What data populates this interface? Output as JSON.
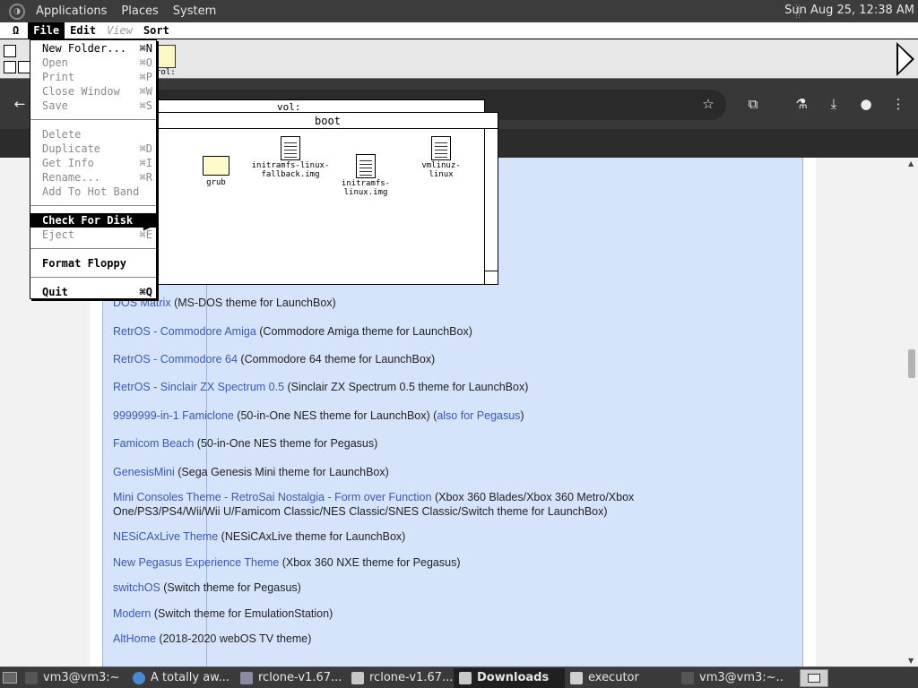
{
  "gnome": {
    "menus": [
      "Applications",
      "Places",
      "System"
    ],
    "clock": "Sun Aug 25, 12:38 AM"
  },
  "mac_menubar": {
    "apple": "Ω",
    "items": [
      {
        "label": "File",
        "state": "selected"
      },
      {
        "label": "Edit",
        "state": "normal"
      },
      {
        "label": "View",
        "state": "disabled"
      },
      {
        "label": "Sort",
        "state": "normal"
      }
    ]
  },
  "mac_desktop": {
    "disk_label": "rol:"
  },
  "file_menu": {
    "items": [
      {
        "label": "New Folder...",
        "key": "⌘N",
        "state": "enabled"
      },
      {
        "label": "Open",
        "key": "⌘O",
        "state": "disabled"
      },
      {
        "label": "Print",
        "key": "⌘P",
        "state": "disabled"
      },
      {
        "label": "Close Window",
        "key": "⌘W",
        "state": "disabled"
      },
      {
        "label": "Save",
        "key": "⌘S",
        "state": "disabled"
      },
      {
        "label": "Delete",
        "key": "",
        "state": "disabled"
      },
      {
        "label": "Duplicate",
        "key": "⌘D",
        "state": "disabled"
      },
      {
        "label": "Get Info",
        "key": "⌘I",
        "state": "disabled"
      },
      {
        "label": "Rename...",
        "key": "⌘R",
        "state": "disabled"
      },
      {
        "label": "Add To Hot Band",
        "key": "",
        "state": "disabled"
      },
      {
        "label": "Check For Disk",
        "key": "",
        "state": "highlighted"
      },
      {
        "label": "Eject",
        "key": "⌘E",
        "state": "disabled"
      },
      {
        "label": "Format Floppy",
        "key": "",
        "state": "bold"
      },
      {
        "label": "Quit",
        "key": "⌘Q",
        "state": "bold"
      }
    ]
  },
  "vol_window": {
    "title": "vol:"
  },
  "boot_window": {
    "title": "boot",
    "files": [
      {
        "name": "grub",
        "type": "folder"
      },
      {
        "name": "initramfs-linux-fallback.img",
        "type": "document"
      },
      {
        "name": "initramfs-linux.img",
        "type": "document"
      },
      {
        "name": "vmlinuz-linux",
        "type": "document"
      }
    ]
  },
  "page_list": [
    {
      "link": "DOS Matrix",
      "text": " (MS-DOS theme for LaunchBox)"
    },
    {
      "link": "RetrOS - Commodore Amiga",
      "text": " (Commodore Amiga theme for LaunchBox)"
    },
    {
      "link": "RetrOS - Commodore 64",
      "text": " (Commodore 64 theme for LaunchBox)"
    },
    {
      "link": "RetrOS - Sinclair ZX Spectrum 0.5",
      "text": " (Sinclair ZX Spectrum 0.5 theme for LaunchBox)"
    },
    {
      "link": "9999999-in-1 Famiclone",
      "text": " (50-in-One NES theme for LaunchBox) (",
      "link2": "also for Pegasus",
      "text2": ")"
    },
    {
      "link": "Famicom Beach",
      "text": " (50-in-One NES theme for Pegasus)"
    },
    {
      "link": "GenesisMini",
      "text": " (Sega Genesis Mini theme for LaunchBox)"
    },
    {
      "link": "Mini Consoles Theme - RetroSai Nostalgia - Form over Function",
      "text": " (Xbox 360 Blades/Xbox 360 Metro/Xbox One/PS3/PS4/Wii/Wii U/Famicom Classic/NES Classic/SNES Classic/Switch theme for LaunchBox)"
    },
    {
      "link": "NESiCAxLive Theme",
      "text": " (NESiCAxLive theme for LaunchBox)"
    },
    {
      "link": "New Pegasus Experience Theme",
      "text": " (Xbox 360 NXE theme for Pegasus)"
    },
    {
      "link": "switchOS",
      "text": " (Switch theme for Pegasus)"
    },
    {
      "link": "Modern",
      "text": " (Switch theme for EmulationStation)"
    },
    {
      "link": "AltHome",
      "text": " (2018-2020 webOS TV theme)"
    }
  ],
  "taskbar": {
    "items": [
      {
        "label": "vm3@vm3:~",
        "icon": "terminal-icon",
        "active": false
      },
      {
        "label": "A totally aw...",
        "icon": "chrome-icon",
        "active": false
      },
      {
        "label": "rclone-v1.67...",
        "icon": "archive-icon",
        "active": false
      },
      {
        "label": "rclone-v1.67...",
        "icon": "folder-icon",
        "active": false
      },
      {
        "label": "Downloads",
        "icon": "folder-icon",
        "active": true
      },
      {
        "label": "executor",
        "icon": "window-icon",
        "active": false
      },
      {
        "label": "vm3@vm3:~...",
        "icon": "terminal-icon",
        "active": false
      }
    ]
  },
  "colors": {
    "link": "#3a58b4",
    "page_bg": "#d6e4fb",
    "menu_highlight": "#000000"
  }
}
